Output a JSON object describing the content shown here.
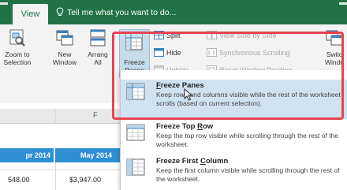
{
  "tabs": {
    "active_label": "View",
    "tell_me": "Tell me what you want to do..."
  },
  "ribbon": {
    "zoom_to_selection": {
      "line1": "Zoom to",
      "line2": "Selection"
    },
    "new_window": {
      "line1": "New",
      "line2": "Window"
    },
    "arrange_all": {
      "line1": "Arrang",
      "line2": "All"
    },
    "freeze_panes": {
      "line1": "Freeze",
      "line2": "Panes"
    },
    "split": "Split",
    "hide": "Hide",
    "unhide": "Unhide",
    "view_side_by_side": "View Side by Side",
    "synchronous_scrolling": "Synchronous Scrolling",
    "reset_window_position": "Reset Window Position",
    "switch_windows": {
      "line1": "Switc",
      "line2": "Windo"
    }
  },
  "grid": {
    "col_f": "F",
    "headers": [
      "pr 2014",
      "May 2014"
    ],
    "values": [
      "548.00",
      "$3,947.00"
    ]
  },
  "menu": {
    "items": [
      {
        "title_ul": "F",
        "title_rest": "reeze Panes",
        "desc": "Keep rows and columns visible while the rest of the worksheet scrolls (based on current selection)."
      },
      {
        "title_pre": "Freeze Top ",
        "title_ul": "R",
        "title_rest": "ow",
        "desc": "Keep the top row visible while scrolling through the rest of the worksheet."
      },
      {
        "title_pre": "Freeze First ",
        "title_ul": "C",
        "title_rest": "olumn",
        "desc": "Keep the first column visible while scrolling through the rest of the worksheet."
      }
    ]
  },
  "colors": {
    "excel_green": "#217346",
    "highlight_blue": "#cfe2f2",
    "header_blue": "#2e8fd4",
    "callout_red": "#e74452"
  }
}
